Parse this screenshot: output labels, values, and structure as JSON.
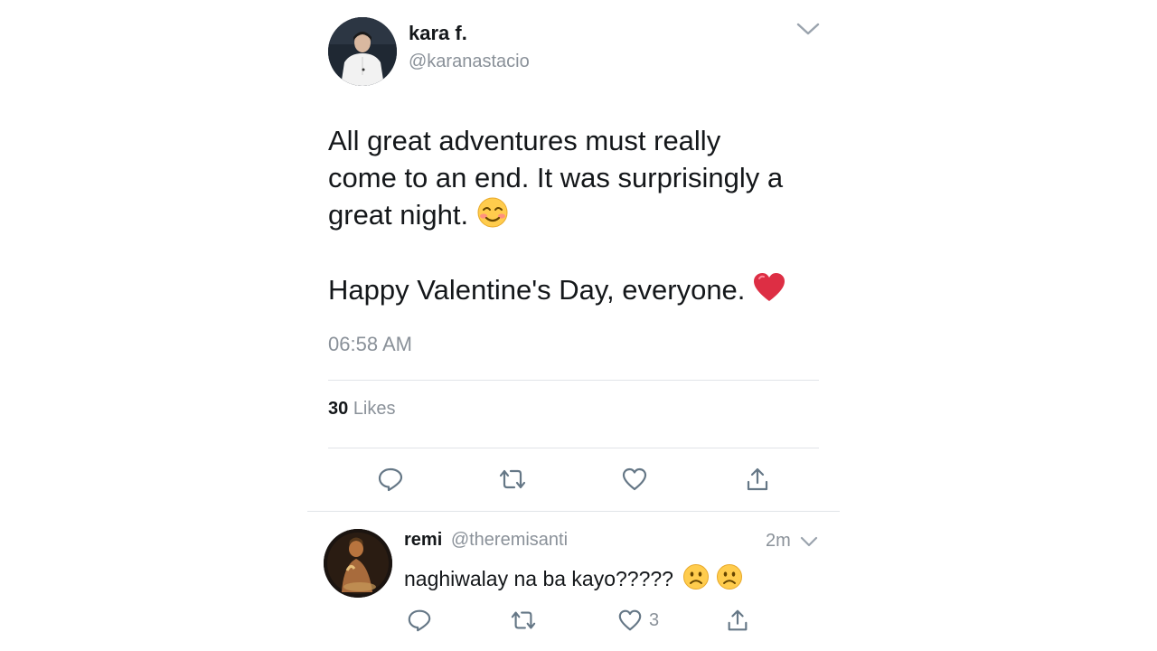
{
  "main_tweet": {
    "author_name": "kara f.",
    "author_handle": "@karanastacio",
    "text_lines": [
      "All great adventures must really",
      "come to an end. It was surprisingly a",
      "great night."
    ],
    "text_line_2": "Happy Valentine's Day, everyone.",
    "emoji_1": "relieved-smile-emoji",
    "emoji_2": "red-heart-emoji",
    "time": "06:58 AM",
    "likes_count": "30",
    "likes_label": "Likes",
    "actions": [
      "reply-icon",
      "retweet-icon",
      "like-icon",
      "share-icon"
    ]
  },
  "reply": {
    "author_name": "remi",
    "author_handle": "@theremisanti",
    "age": "2m",
    "text": "naghiwalay na ba kayo?????",
    "emojis": [
      "frowning-face-emoji",
      "frowning-face-emoji"
    ],
    "like_count": "3",
    "actions": [
      "reply-icon",
      "retweet-icon",
      "like-icon",
      "share-icon"
    ]
  },
  "colors": {
    "text": "#14171a",
    "muted": "#8a9199",
    "divider": "#e1e4e8",
    "heart": "#e0245e"
  }
}
